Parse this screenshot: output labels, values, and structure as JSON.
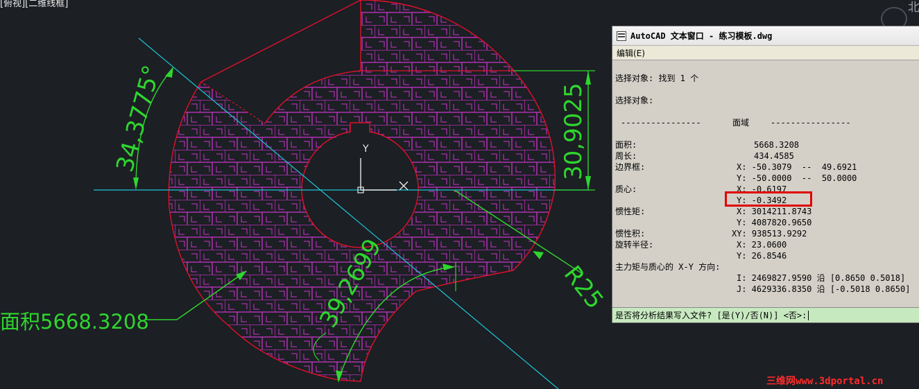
{
  "viewport": {
    "label": "[俯视][二维线框]",
    "north": "北",
    "dimensions": {
      "angle1": "34,3775°",
      "vertical": "30,9025",
      "radius": "R25",
      "angle2": "39,2699"
    },
    "area_label": "面积5668.3208",
    "ucs": {
      "x": "X",
      "y": "Y"
    },
    "colors": {
      "background": "#1c1f24",
      "boundary": "#e0102a",
      "hatch": "#cc33cc",
      "axis": "#19c8d8",
      "dimension": "#2fd62f"
    }
  },
  "text_window": {
    "title": "AutoCAD 文本窗口 - 练习模板.dwg",
    "menu_edit": "编辑(E)",
    "lines": {
      "sel_found": "选择对象: 找到 1 个",
      "sel_prompt": "选择对象:",
      "sep_left": "----------------",
      "sep_title": "面域",
      "sep_right": "----------------",
      "area_name": "面积:",
      "area_value": "5668.3208",
      "perimeter_name": "周长:",
      "perimeter_value": "434.4585",
      "bbox_name": "边界框:",
      "bbox_x": "X: -50.3079  --  49.6921",
      "bbox_y": "Y: -50.0000  --  50.0000",
      "centroid_name": "质心:",
      "centroid_x": "X: -0.6197",
      "centroid_y": "Y: -0.3492",
      "moi_name": "惯性矩:",
      "moi_x": "X: 3014211.8743",
      "moi_y": "Y: 4087820.9650",
      "poi_name": "惯性积:",
      "poi_xy": "XY: 938513.9292",
      "gyr_name": "旋转半径:",
      "gyr_x": "X: 23.0600",
      "gyr_y": "Y: 26.8546",
      "principal_name": "主力矩与质心的 X-Y 方向:",
      "principal_i": "I: 2469827.9590 沿 [0.8650 0.5018]",
      "principal_j": "J: 4629336.8350 沿 [-0.5018 0.8650]"
    },
    "command_prompt": "是否将分析结果写入文件? [是(Y)/否(N)] <否>:"
  },
  "watermark": "三维网www.3dportal.cn"
}
